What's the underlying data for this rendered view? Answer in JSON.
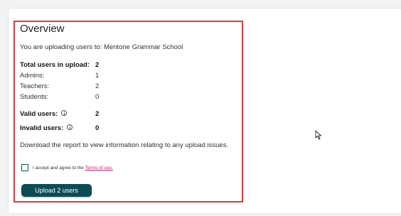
{
  "overview": {
    "heading": "Overview",
    "upload_target": "You are uploading users to: Mentone Grammar School",
    "stats": {
      "total": {
        "label": "Total users in upload:",
        "value": "2"
      },
      "admins": {
        "label": "Admins:",
        "value": "1"
      },
      "teachers": {
        "label": "Teachers:",
        "value": "2"
      },
      "students": {
        "label": "Students:",
        "value": "0"
      },
      "valid": {
        "label": "Valid users:",
        "value": "2"
      },
      "invalid": {
        "label": "Invalid users:",
        "value": "0"
      }
    },
    "download_text": "Download the report to view information relating to any upload issues.",
    "agreement": {
      "text": "I accept and agree to the",
      "link_text": "Terms of use.",
      "checked": false
    },
    "upload_button_label": "Upload 2 users"
  },
  "colors": {
    "highlight_border": "#e03a3a",
    "primary_button": "#0d4b55",
    "link": "#c2186b"
  }
}
